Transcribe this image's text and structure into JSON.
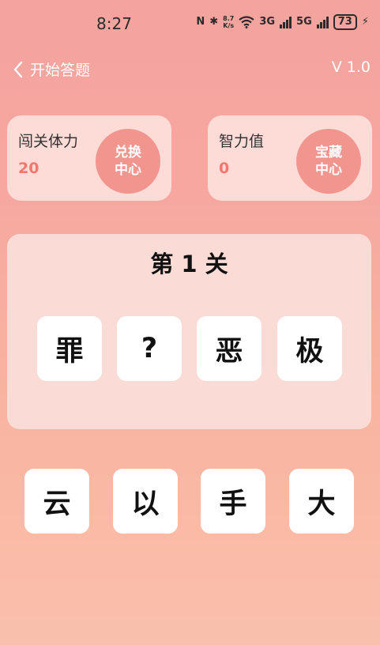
{
  "status_bar": {
    "time": "8:27",
    "nfc": "N",
    "bluetooth": "✱",
    "speed_value": "8.7",
    "speed_unit": "K/s",
    "net1": "3G",
    "net2": "5G",
    "battery": "73"
  },
  "header": {
    "back_label": "开始答题",
    "version": "V 1.0"
  },
  "stats": {
    "stamina": {
      "title": "闯关体力",
      "value": "20",
      "button_line1": "兑换",
      "button_line2": "中心"
    },
    "intelligence": {
      "title": "智力值",
      "value": "0",
      "button_line1": "宝藏",
      "button_line2": "中心"
    }
  },
  "puzzle": {
    "level": "第 1 关",
    "slots": [
      "罪",
      "?",
      "恶",
      "极"
    ]
  },
  "options": [
    "云",
    "以",
    "手",
    "大"
  ],
  "colors": {
    "accent": "#f3776c",
    "button": "#f3958f"
  }
}
